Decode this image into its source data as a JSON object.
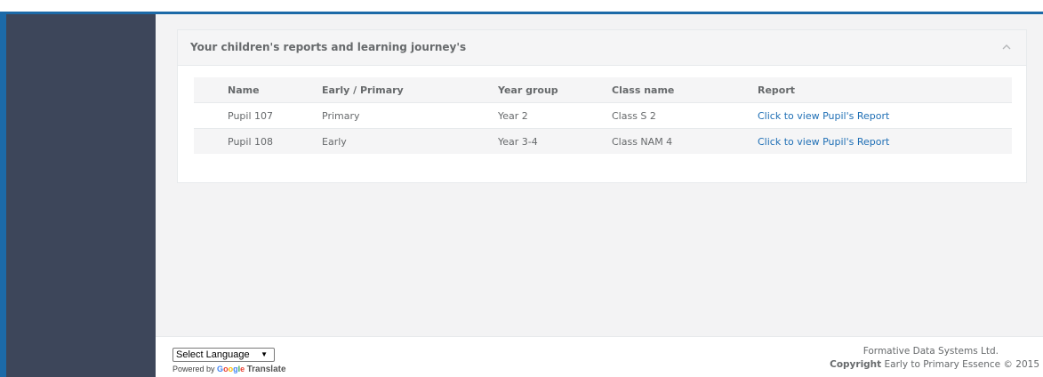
{
  "panel": {
    "title": "Your children's reports and learning journey's"
  },
  "table": {
    "headers": [
      "Name",
      "Early / Primary",
      "Year group",
      "Class name",
      "Report"
    ],
    "rows": [
      [
        "Pupil 107",
        "Primary",
        "Year 2",
        "Class S 2",
        "Click to view Pupil's Report"
      ],
      [
        "Pupil 108",
        "Early",
        "Year 3-4",
        "Class NAM 4",
        "Click to view Pupil's Report"
      ]
    ]
  },
  "footer": {
    "language_select": "Select Language",
    "powered_by": "Powered by",
    "google": "Google",
    "translate": "Translate",
    "company": "Formative Data Systems Ltd.",
    "copyright_label": "Copyright",
    "copyright_text": "Early to Primary Essence © 2015"
  },
  "colors": {
    "sidebar": "#3d465a",
    "accent": "#1c6aa8",
    "link": "#1f6fb5"
  },
  "icons": {
    "collapse": "chevron-up-icon",
    "select_arrow": "caret-down-icon"
  }
}
